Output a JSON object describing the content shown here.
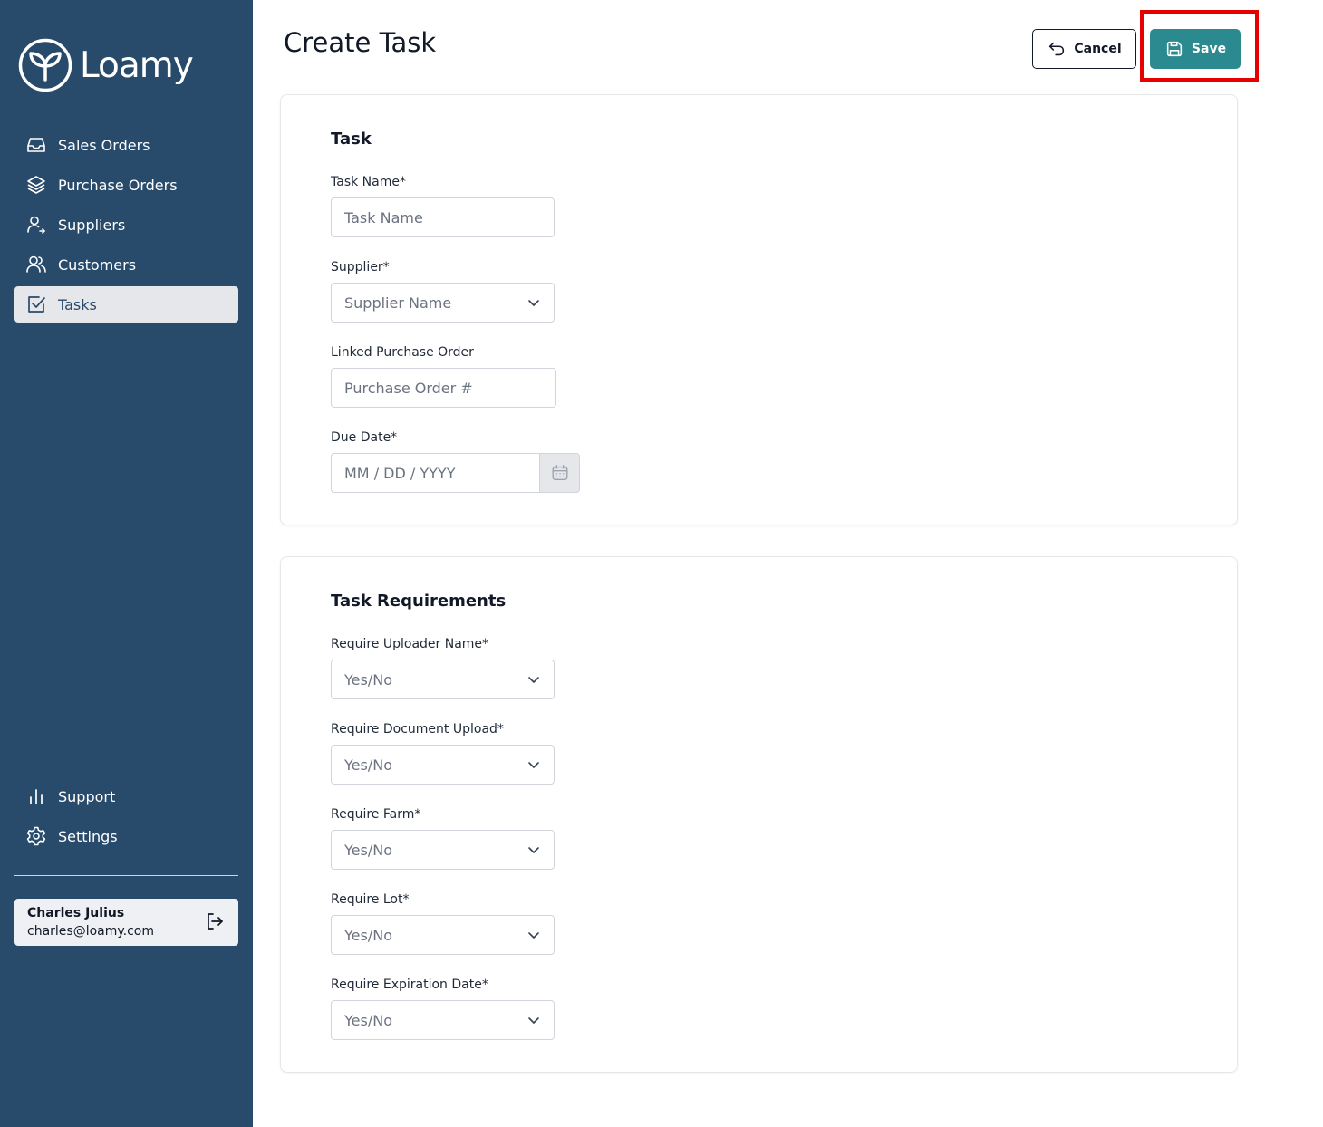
{
  "app": {
    "logo_text": "Loamy"
  },
  "sidebar": {
    "items": [
      {
        "label": "Sales Orders",
        "icon": "inbox-icon"
      },
      {
        "label": "Purchase Orders",
        "icon": "layers-icon"
      },
      {
        "label": "Suppliers",
        "icon": "user-arrow-icon"
      },
      {
        "label": "Customers",
        "icon": "users-icon"
      },
      {
        "label": "Tasks",
        "icon": "checkbox-icon",
        "active": true
      }
    ],
    "bottom_items": [
      {
        "label": "Support",
        "icon": "bar-chart-icon"
      },
      {
        "label": "Settings",
        "icon": "gear-icon"
      }
    ],
    "user": {
      "name": "Charles Julius",
      "email": "charles@loamy.com"
    }
  },
  "header": {
    "title": "Create Task",
    "cancel_label": "Cancel",
    "save_label": "Save"
  },
  "task_section": {
    "title": "Task",
    "task_name": {
      "label": "Task Name*",
      "placeholder": "Task Name"
    },
    "supplier": {
      "label": "Supplier*",
      "placeholder": "Supplier Name"
    },
    "linked_po": {
      "label": "Linked Purchase Order",
      "placeholder": "Purchase Order #"
    },
    "due_date": {
      "label": "Due Date*",
      "placeholder": "MM / DD / YYYY"
    }
  },
  "requirements_section": {
    "title": "Task Requirements",
    "fields": [
      {
        "label": "Require Uploader Name*",
        "value": "Yes/No"
      },
      {
        "label": "Require Document Upload*",
        "value": "Yes/No"
      },
      {
        "label": "Require Farm*",
        "value": "Yes/No"
      },
      {
        "label": "Require Lot*",
        "value": "Yes/No"
      },
      {
        "label": "Require Expiration Date*",
        "value": "Yes/No"
      }
    ]
  },
  "colors": {
    "sidebar_bg": "#284a6b",
    "save_button": "#2a8a8f",
    "annotation_red": "#e60000"
  }
}
